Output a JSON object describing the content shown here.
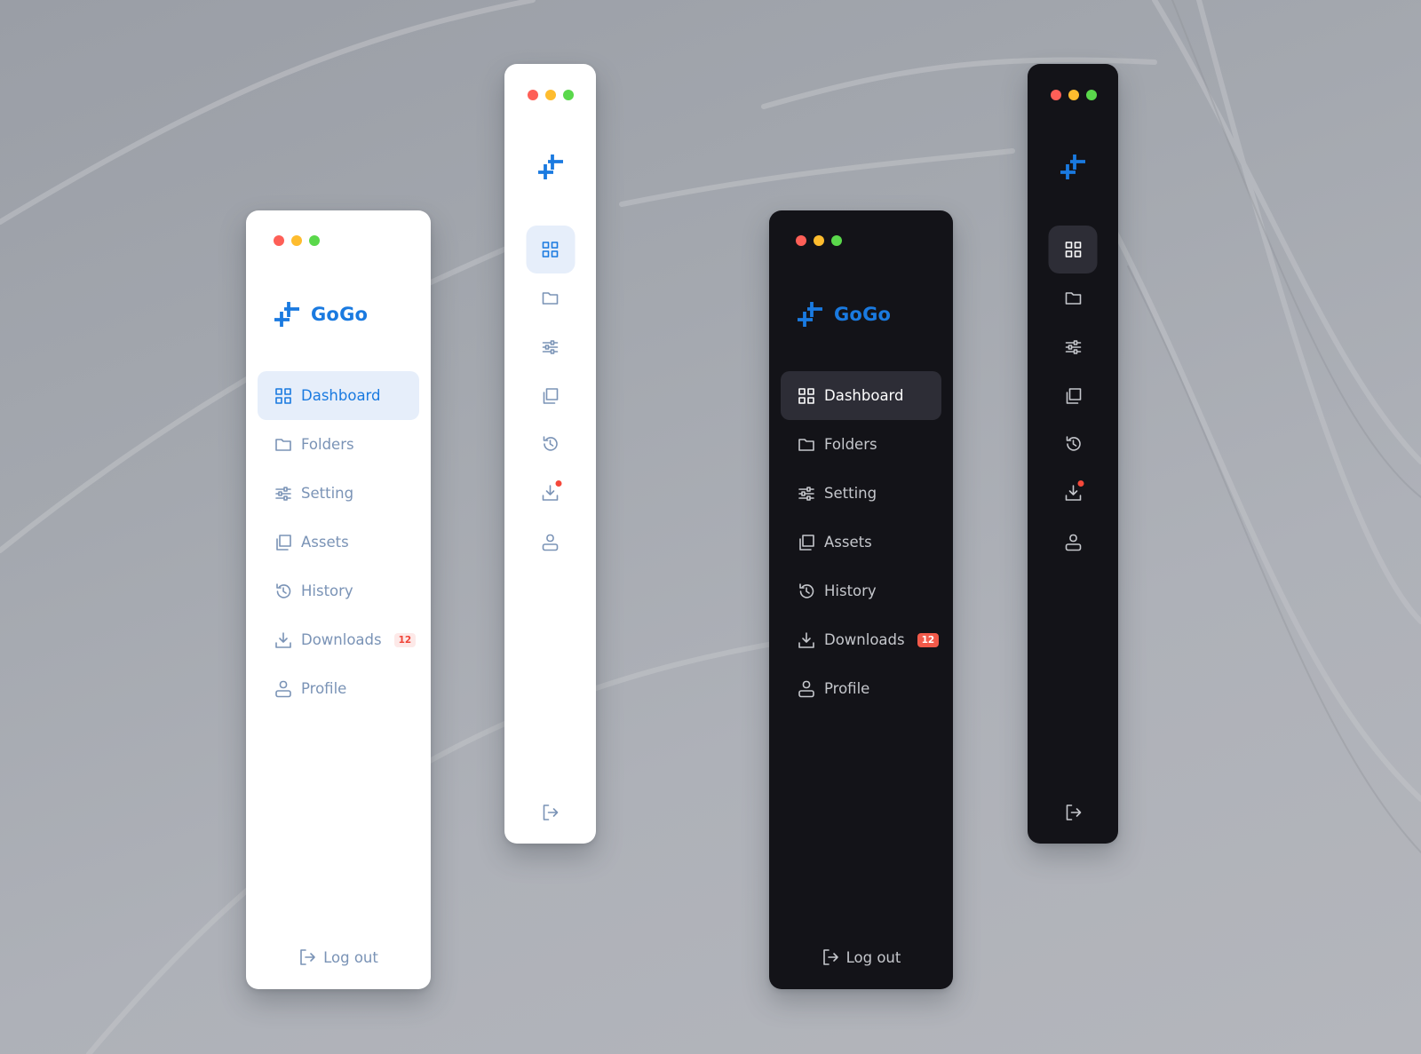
{
  "app": {
    "name": "GoGo",
    "accent_color": "#1a7ae0",
    "badge_color": "#f04438"
  },
  "window_controls": [
    "close",
    "minimize",
    "maximize"
  ],
  "nav_items": [
    {
      "key": "dashboard",
      "label": "Dashboard",
      "icon": "grid-icon",
      "active": true
    },
    {
      "key": "folders",
      "label": "Folders",
      "icon": "folder-icon"
    },
    {
      "key": "setting",
      "label": "Setting",
      "icon": "sliders-icon"
    },
    {
      "key": "assets",
      "label": "Assets",
      "icon": "copy-icon"
    },
    {
      "key": "history",
      "label": "History",
      "icon": "history-icon"
    },
    {
      "key": "downloads",
      "label": "Downloads",
      "icon": "download-icon",
      "badge": "12"
    },
    {
      "key": "profile",
      "label": "Profile",
      "icon": "user-icon"
    }
  ],
  "logout": {
    "label": "Log out",
    "icon": "logout-icon"
  },
  "variants": [
    "light-expanded",
    "light-collapsed",
    "dark-expanded",
    "dark-collapsed"
  ]
}
